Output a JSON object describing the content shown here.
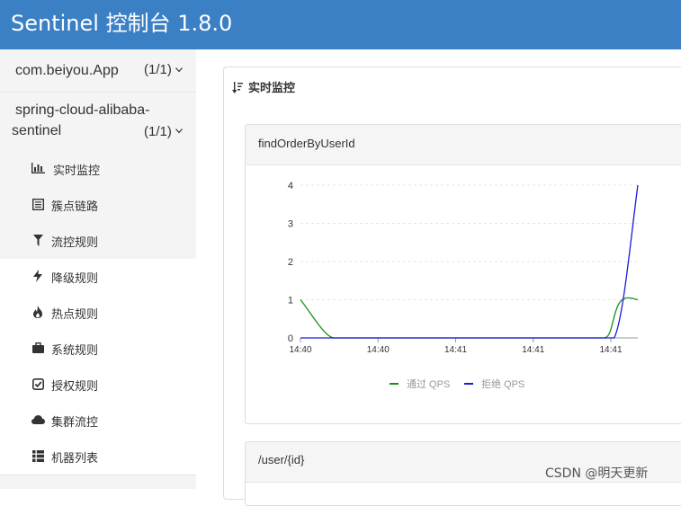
{
  "app_title": "Sentinel 控制台 1.8.0",
  "sidebar": {
    "apps": [
      {
        "name": "com.beiyou.App",
        "count": "(1/1)"
      },
      {
        "name": "spring-cloud-alibaba-sentinel",
        "count": "(1/1)"
      }
    ],
    "items": [
      {
        "label": "实时监控",
        "icon": "bar-chart-icon"
      },
      {
        "label": "簇点链路",
        "icon": "list-icon"
      },
      {
        "label": "流控规则",
        "icon": "filter-icon"
      },
      {
        "label": "降级规则",
        "icon": "flash-icon"
      },
      {
        "label": "热点规则",
        "icon": "fire-icon"
      },
      {
        "label": "系统规则",
        "icon": "briefcase-icon"
      },
      {
        "label": "授权规则",
        "icon": "check-square-icon"
      },
      {
        "label": "集群流控",
        "icon": "cloud-icon"
      },
      {
        "label": "机器列表",
        "icon": "th-list-icon"
      }
    ]
  },
  "main": {
    "section_title": "实时监控",
    "cards": [
      {
        "title": "findOrderByUserId"
      },
      {
        "title": "/user/{id}"
      }
    ]
  },
  "watermark": "CSDN @明天更新",
  "chart_data": {
    "type": "line",
    "title": "",
    "xlabel": "",
    "ylabel": "",
    "x_ticks": [
      "14:40",
      "14:40",
      "14:41",
      "14:41",
      "14:41"
    ],
    "y_ticks": [
      "0",
      "1",
      "2",
      "3",
      "4"
    ],
    "ylim": [
      0,
      4
    ],
    "grid": true,
    "legend": "bottom",
    "series": [
      {
        "name": "通过 QPS",
        "color": "#1a8f1a",
        "points": [
          [
            0,
            1
          ],
          [
            0.1,
            0
          ],
          [
            0.9,
            0
          ],
          [
            0.97,
            1.05
          ],
          [
            1.0,
            1.0
          ]
        ]
      },
      {
        "name": "拒绝 QPS",
        "color": "#1a1adb",
        "points": [
          [
            0,
            0
          ],
          [
            0.93,
            0
          ],
          [
            1.0,
            4
          ]
        ]
      }
    ]
  }
}
